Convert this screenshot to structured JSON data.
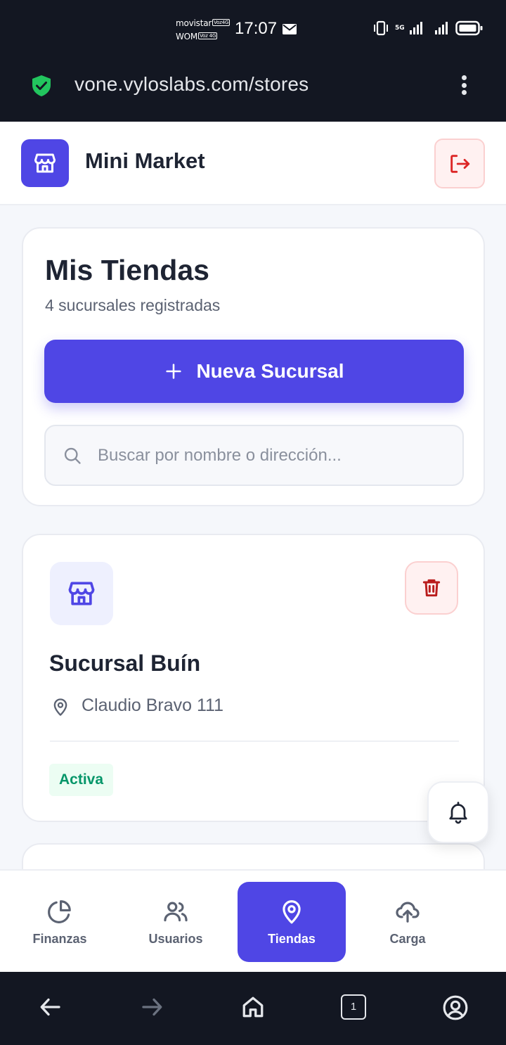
{
  "status_bar": {
    "carrier_1": "movistar",
    "carrier_1_tag": "Voz4G",
    "carrier_2": "WOM",
    "carrier_2_tag": "Voz 4G",
    "time": "17:07",
    "network": "5G"
  },
  "browser": {
    "url": "vone.vyloslabs.com/stores",
    "tab_count": "1"
  },
  "header": {
    "title": "Mini Market"
  },
  "stores_page": {
    "title": "Mis Tiendas",
    "subtitle": "4 sucursales registradas",
    "new_button_label": "Nueva Sucursal",
    "search_placeholder": "Buscar por nombre o dirección..."
  },
  "stores": [
    {
      "name": "Sucursal Buín",
      "address": "Claudio Bravo 111",
      "status": "Activa"
    }
  ],
  "bottom_nav": {
    "items": [
      {
        "label": "Finanzas",
        "icon": "pie-chart-icon"
      },
      {
        "label": "Usuarios",
        "icon": "users-icon"
      },
      {
        "label": "Tiendas",
        "icon": "map-pin-icon",
        "active": true
      },
      {
        "label": "Carga",
        "icon": "upload-cloud-icon"
      }
    ]
  },
  "colors": {
    "primary": "#4f46e5",
    "danger": "#dc2626",
    "success": "#059669",
    "text": "#1e2433",
    "muted": "#5b6272"
  }
}
